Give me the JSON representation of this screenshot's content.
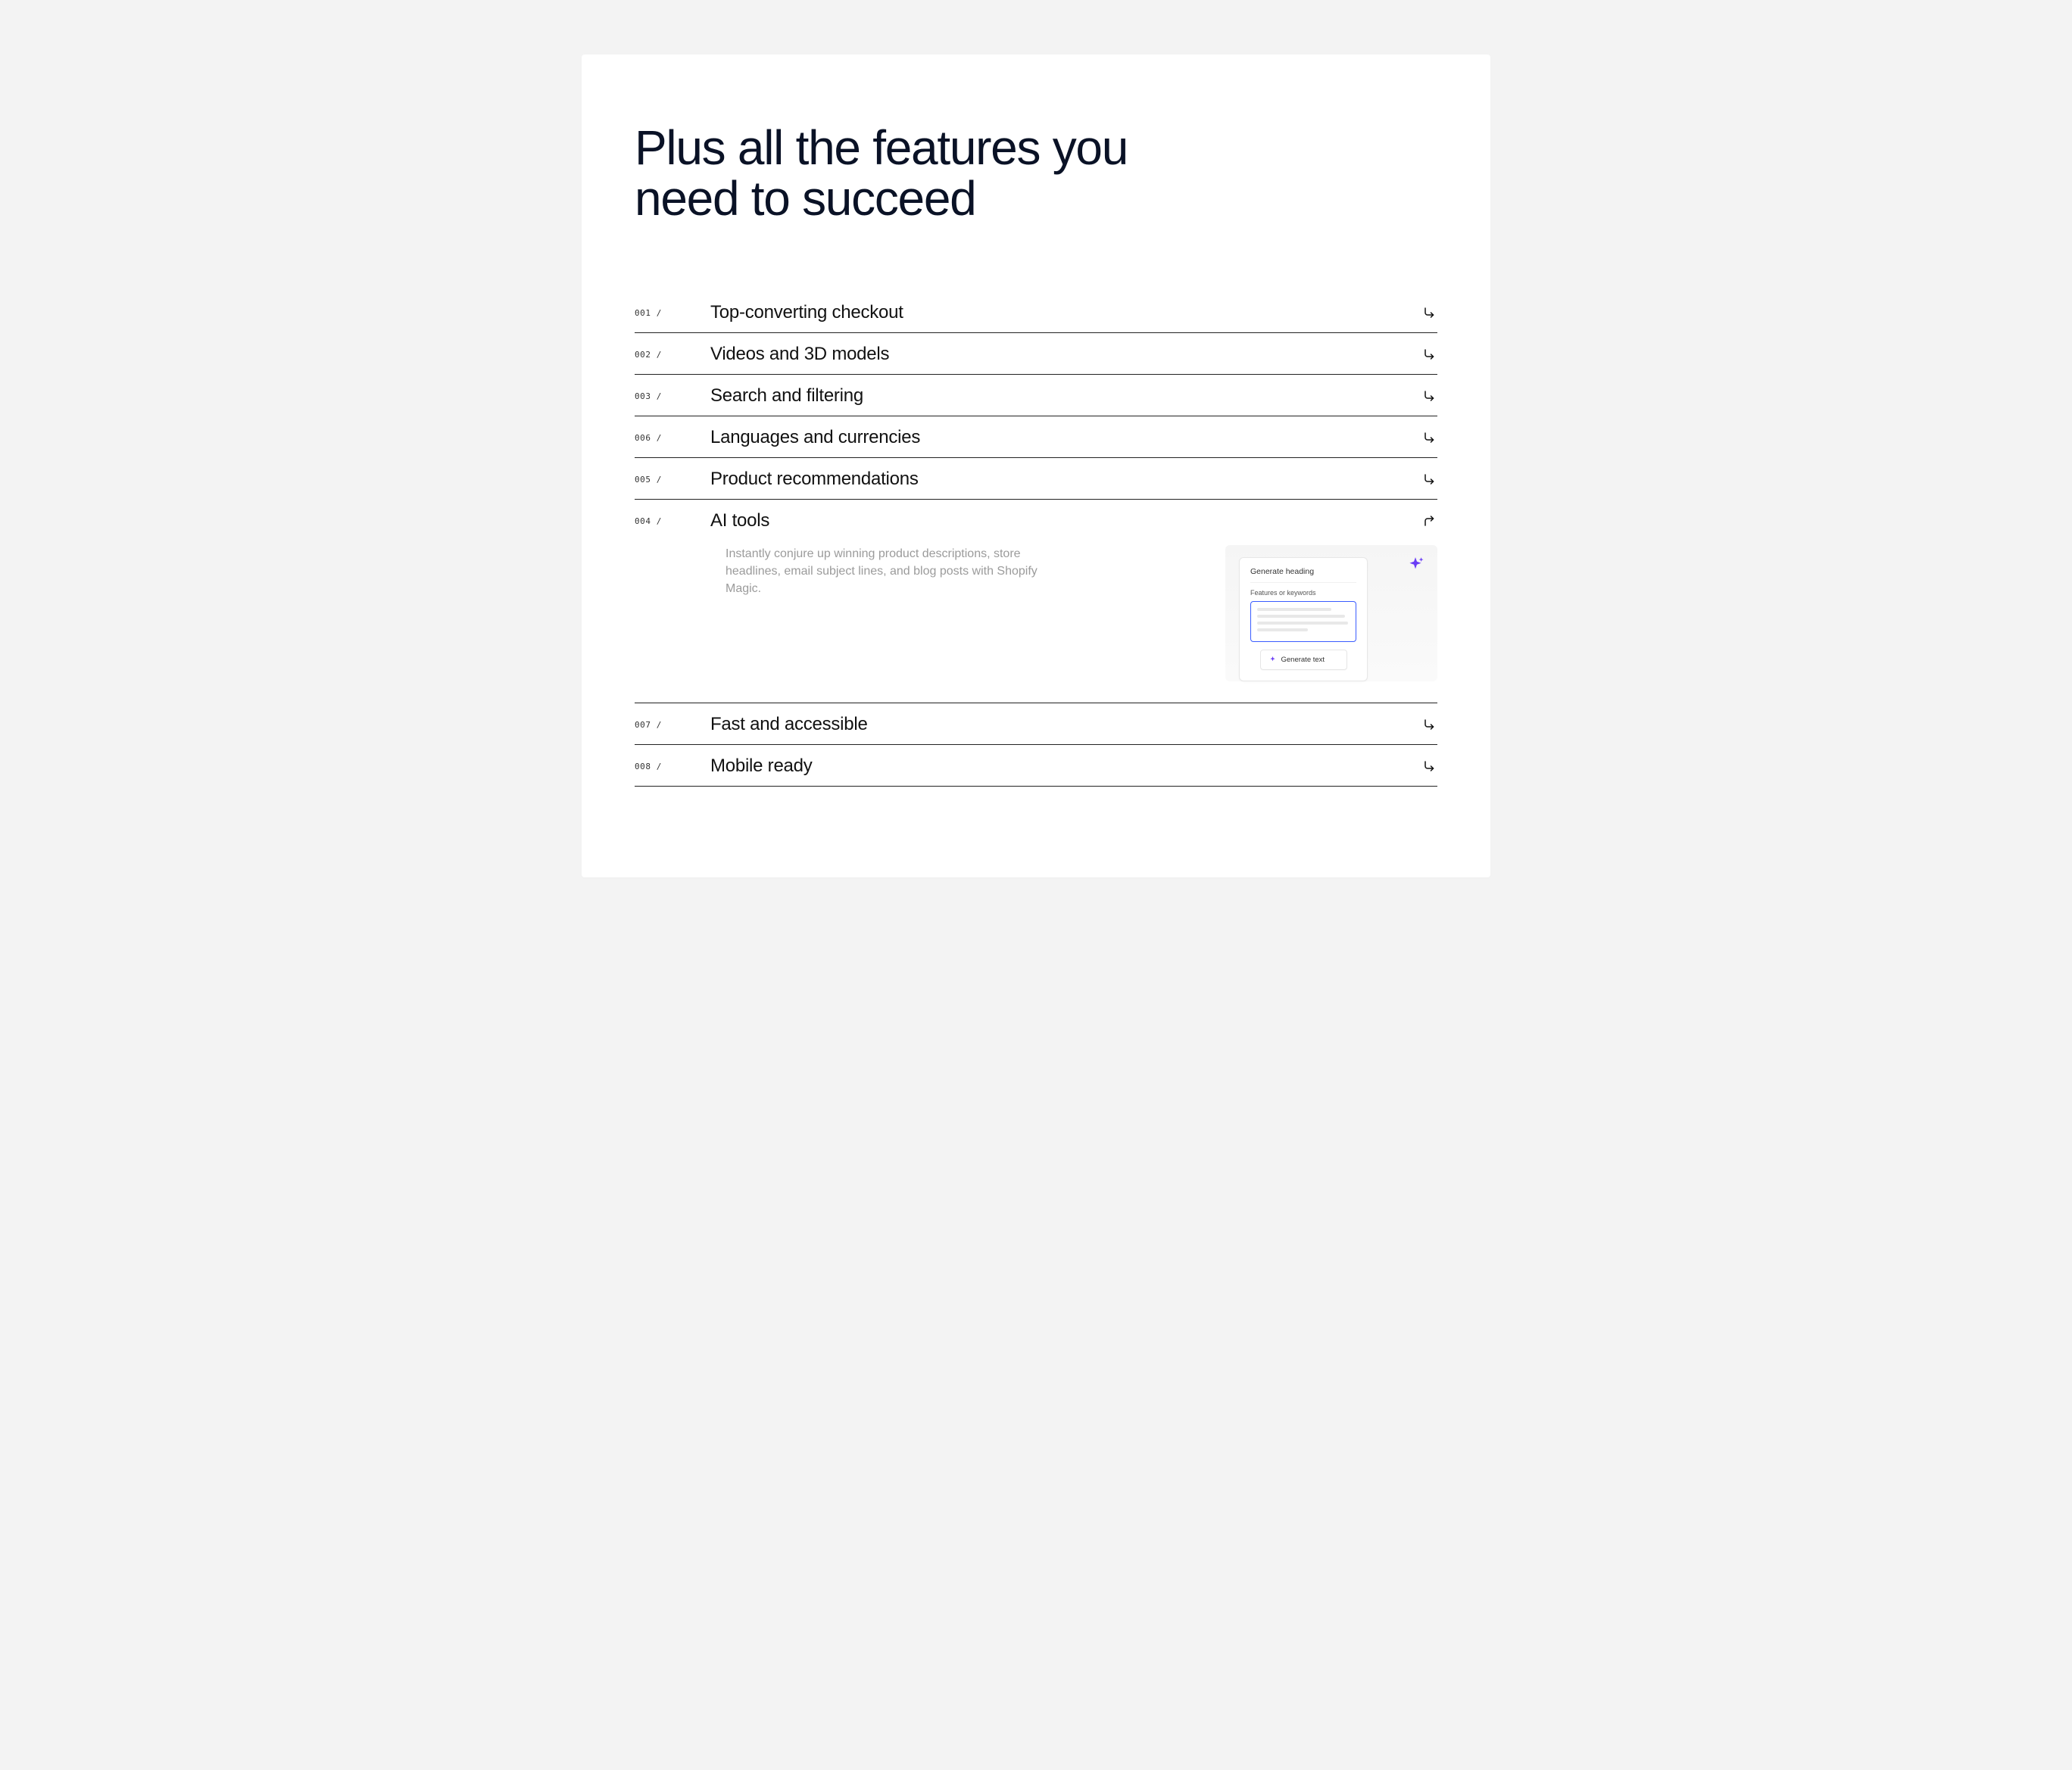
{
  "headline": "Plus all the features you need to succeed",
  "accordion": [
    {
      "num": "001 /",
      "title": "Top-converting checkout",
      "expanded": false
    },
    {
      "num": "002 /",
      "title": "Videos and 3D models",
      "expanded": false
    },
    {
      "num": "003 /",
      "title": "Search and filtering",
      "expanded": false
    },
    {
      "num": "006 /",
      "title": "Languages and currencies",
      "expanded": false
    },
    {
      "num": "005 /",
      "title": "Product recommendations",
      "expanded": false
    },
    {
      "num": "004 /",
      "title": "AI tools",
      "expanded": true,
      "description": "Instantly conjure up winning product descriptions, store headlines, email subject lines, and blog posts with Shopify Magic.",
      "illustration": {
        "heading": "Generate heading",
        "field_label": "Features or keywords",
        "button_label": "Generate text"
      }
    },
    {
      "num": "007 /",
      "title": "Fast and accessible",
      "expanded": false
    },
    {
      "num": "008 /",
      "title": "Mobile ready",
      "expanded": false
    }
  ]
}
